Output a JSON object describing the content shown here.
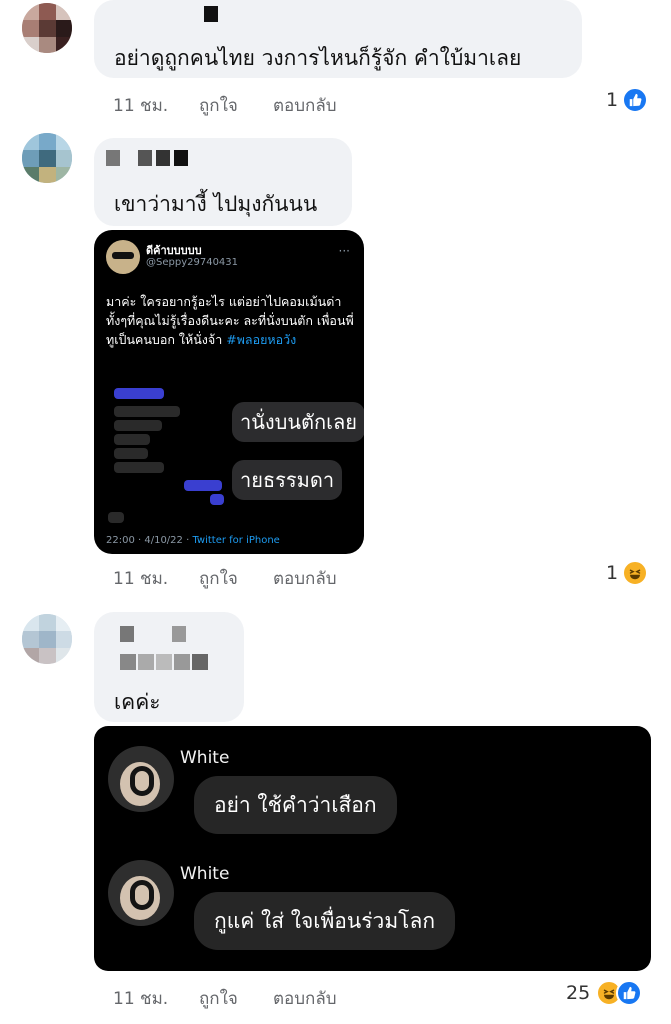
{
  "comments": [
    {
      "text": "อย่าดูถูกคนไทย วงการไหนก็รู้จัก คำใบ้มาเลย",
      "time": "11 ชม.",
      "like_label": "ถูกใจ",
      "reply_label": "ตอบกลับ",
      "reaction_count": "1",
      "reaction": "like-icon"
    },
    {
      "text": "เขาว่ามางี้ ไปมุงกันนน",
      "time": "11 ชม.",
      "like_label": "ถูกใจ",
      "reply_label": "ตอบกลับ",
      "reaction_count": "1",
      "reaction": "haha-icon"
    },
    {
      "text": "เคค่ะ",
      "time": "11 ชม.",
      "like_label": "ถูกใจ",
      "reply_label": "ตอบกลับ",
      "reaction_count": "25",
      "reaction": "haha-like-icons"
    }
  ],
  "tweet": {
    "name": "ดีค้าบบบบบ",
    "handle": "@Seppy29740431",
    "more": "···",
    "body": "มาค่ะ ใครอยากรู้อะไร แต่อย่าไปคอมเม้นด่า ทั้งๆที่คุณไม่รู้เรื่องดีนะคะ ละที่นั่งบนตัก เพื่อนพี่ทูเป็นคนบอก ให้นั่งจ้า",
    "hashtag": "#พลอยหอวัง",
    "inner_big_1": "านั่งบนตักเลย",
    "inner_big_2": "ายธรรมดา",
    "timestamp": "22:00 · 4/10/22 ·",
    "source": "Twitter for iPhone"
  },
  "dm": {
    "messages": [
      {
        "sender": "White",
        "text": "อย่า ใช้คำว่าเสือก"
      },
      {
        "sender": "White",
        "text": "กูแค่ ใส่ ใจเพื่อนร่วมโลก"
      }
    ]
  },
  "colors": {
    "bubble": "#f0f2f5",
    "meta": "#65676b",
    "like_blue": "#1877f2",
    "haha_yellow": "#f7b125",
    "tweet_bg": "#000000",
    "hashtag": "#1d9bf0"
  }
}
